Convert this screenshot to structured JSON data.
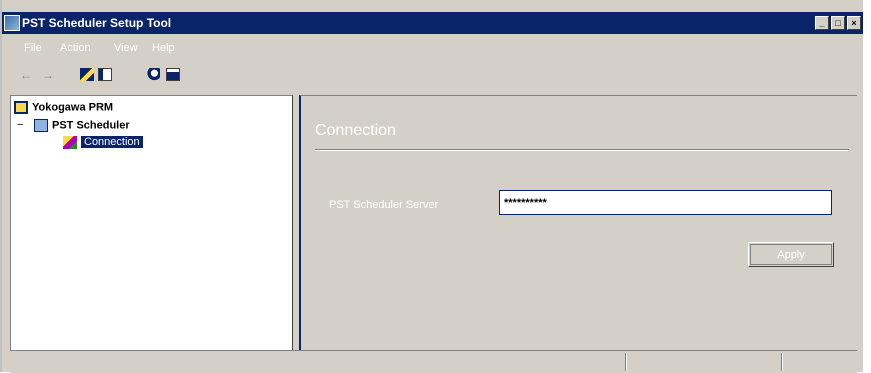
{
  "window": {
    "title": "PST Scheduler Setup Tool",
    "controls": [
      "minimize",
      "maximize",
      "close"
    ]
  },
  "menubar": {
    "items": [
      "File",
      "Action",
      "View",
      "Help"
    ]
  },
  "toolbar": {
    "back_glyph": "←",
    "forward_glyph": "→",
    "icons": [
      "back-icon",
      "forward-icon",
      "up-folder-icon",
      "show-hide-tree-icon",
      "help-icon",
      "console-icon"
    ]
  },
  "tree": {
    "root": "Yokogawa PRM",
    "expander": "−",
    "child": "PST Scheduler",
    "leaf": "Connection"
  },
  "pane": {
    "heading": "Connection",
    "server_label": "PST Scheduler Server",
    "server_value": "**********",
    "apply_label": "Apply"
  },
  "colors": {
    "titlebar": "#0a246a",
    "window_face": "#d4d0c8",
    "selection": "#0a246a"
  }
}
